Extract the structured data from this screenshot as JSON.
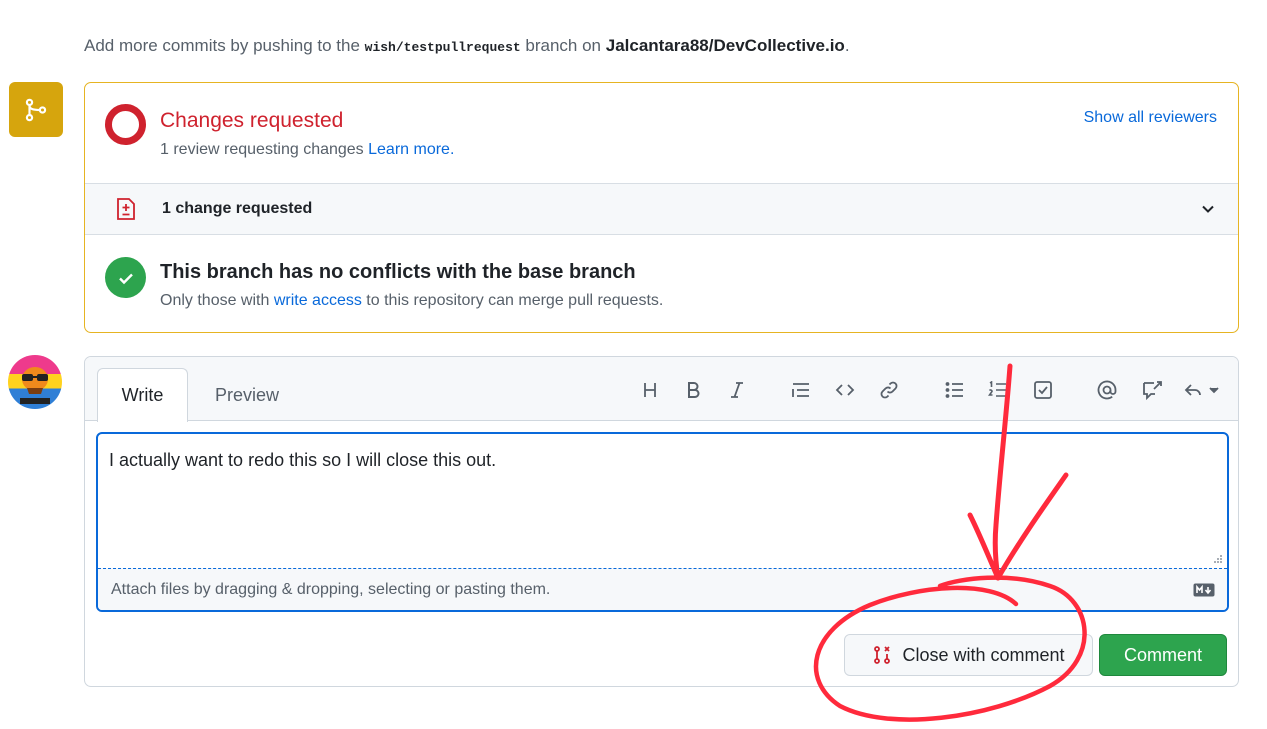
{
  "hint": {
    "prefix": "Add more commits by pushing to the ",
    "branch": "wish/testpullrequest",
    "middle": " branch on ",
    "repo": "Jalcantara88/DevCollective.io",
    "suffix": "."
  },
  "review": {
    "title": "Changes requested",
    "subtitle": "1 review requesting changes ",
    "learn_more": "Learn more.",
    "show_reviewers": "Show all reviewers",
    "changes_count": "1 change requested"
  },
  "merge": {
    "title": "This branch has no conflicts with the base branch",
    "subtitle_prefix": "Only those with ",
    "write_access": "write access",
    "subtitle_suffix": " to this repository can merge pull requests."
  },
  "editor": {
    "tabs": [
      "Write",
      "Preview"
    ],
    "active_tab": "Write",
    "toolbar": [
      "heading-icon",
      "bold-icon",
      "italic-icon",
      "quote-icon",
      "code-icon",
      "link-icon",
      "unordered-list-icon",
      "ordered-list-icon",
      "task-list-icon",
      "mention-icon",
      "reference-icon",
      "reply-icon"
    ],
    "text": "I actually want to redo this so I will close this out.",
    "attach": "Attach files by dragging & dropping, selecting or pasting them."
  },
  "buttons": {
    "close_with_comment": "Close with comment",
    "comment": "Comment"
  },
  "colors": {
    "changes_requested": "#cf222e",
    "success": "#2da44e",
    "merge_pending": "#d6a50d",
    "link": "#0969da",
    "annotation": "#ff2a3c"
  }
}
